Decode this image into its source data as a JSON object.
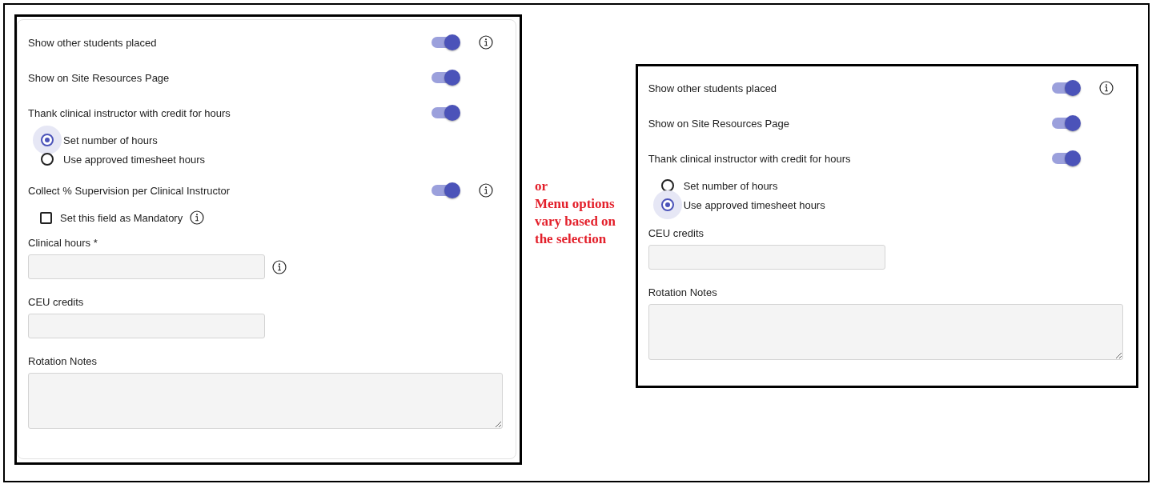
{
  "panels": [
    {
      "card": true,
      "rows": [
        {
          "kind": "toggle",
          "label": "Show other students placed",
          "on": true,
          "info": true
        },
        {
          "kind": "toggle",
          "label": "Show on Site Resources Page",
          "on": true,
          "info": false
        },
        {
          "kind": "toggle",
          "label": "Thank clinical instructor with credit for hours",
          "on": true,
          "info": false
        },
        {
          "kind": "radio-group",
          "options": [
            {
              "label": "Set number of hours",
              "selected": true
            },
            {
              "label": "Use approved timesheet hours",
              "selected": false
            }
          ]
        },
        {
          "kind": "toggle",
          "label": "Collect % Supervision per Clinical Instructor",
          "on": true,
          "info": true
        },
        {
          "kind": "checkbox",
          "label": "Set this field as Mandatory",
          "checked": false,
          "info": true
        },
        {
          "kind": "field",
          "label": "Clinical hours *",
          "info": true
        },
        {
          "kind": "field",
          "label": "CEU credits",
          "info": false
        },
        {
          "kind": "textarea",
          "label": "Rotation Notes"
        }
      ]
    },
    {
      "card": false,
      "rows": [
        {
          "kind": "toggle",
          "label": "Show other students placed",
          "on": true,
          "info": true
        },
        {
          "kind": "toggle",
          "label": "Show on Site Resources Page",
          "on": true,
          "info": false
        },
        {
          "kind": "toggle",
          "label": "Thank clinical instructor with credit for hours",
          "on": true,
          "info": false
        },
        {
          "kind": "radio-group",
          "options": [
            {
              "label": "Set number of hours",
              "selected": false
            },
            {
              "label": "Use approved timesheet hours",
              "selected": true
            }
          ]
        },
        {
          "kind": "field",
          "label": "CEU credits",
          "info": false
        },
        {
          "kind": "textarea",
          "label": "Rotation Notes"
        }
      ]
    }
  ],
  "annotation": {
    "lines": [
      "or",
      "Menu options",
      "vary based on",
      "the selection"
    ]
  }
}
